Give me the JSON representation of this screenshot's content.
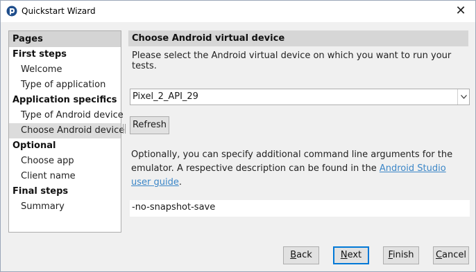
{
  "window": {
    "title": "Quickstart Wizard"
  },
  "sidebar": {
    "header": "Pages",
    "sections": [
      {
        "title": "First steps",
        "items": [
          "Welcome",
          "Type of application"
        ]
      },
      {
        "title": "Application specifics",
        "items": [
          "Type of Android device",
          "Choose Android device"
        ]
      },
      {
        "title": "Optional",
        "items": [
          "Choose app",
          "Client name"
        ]
      },
      {
        "title": "Final steps",
        "items": [
          "Summary"
        ]
      }
    ],
    "active_item": "Choose Android device"
  },
  "main": {
    "title": "Choose Android virtual device",
    "description": "Please select the Android virtual device on which you want to run your tests.",
    "device_select": {
      "value": "Pixel_2_API_29"
    },
    "refresh_label": "Refresh",
    "optional_text_before": "Optionally, you can specify additional command line arguments for the emulator. A respective description can be found in the ",
    "optional_link": "Android Studio user guide",
    "optional_text_after": ".",
    "args_value": "-no-snapshot-save"
  },
  "buttons": {
    "back": {
      "mnemonic": "B",
      "rest": "ack"
    },
    "next": {
      "mnemonic": "N",
      "rest": "ext"
    },
    "finish": {
      "mnemonic": "F",
      "rest": "inish"
    },
    "cancel": {
      "mnemonic": "C",
      "rest": "ancel"
    }
  }
}
